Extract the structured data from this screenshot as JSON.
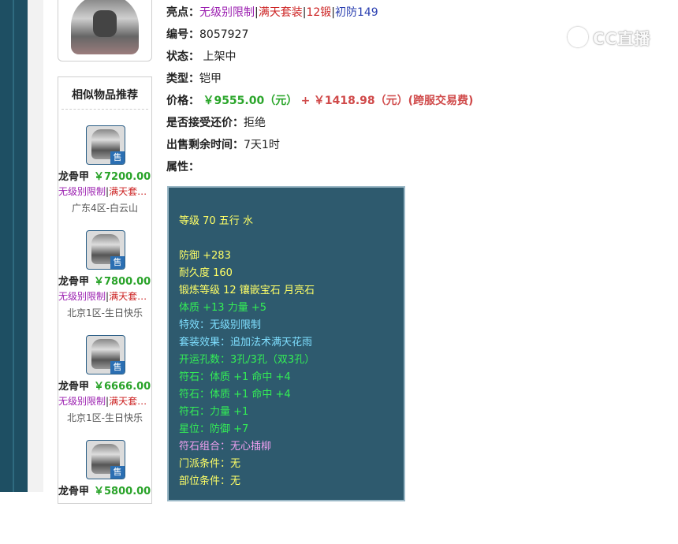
{
  "details": {
    "highlight_label": "亮点：",
    "highlights": [
      "无级别限制",
      "满天套装",
      "12锻",
      "初防149"
    ],
    "serial_label": "编号：",
    "serial": "8057927",
    "status_label": "状态：",
    "status": "上架中",
    "type_label": "类型：",
    "type": "铠甲",
    "price_label": "价格：",
    "price_main": "￥9555.00（元）",
    "price_plus": "+",
    "price_fee": "￥1418.98（元）(跨服交易费)",
    "counter_label": "是否接受还价：",
    "counter": "拒绝",
    "remaining_label": "出售剩余时间：",
    "remaining": "7天1时",
    "attr_label": "属性："
  },
  "attributes": {
    "level": "等级 70 五行 水",
    "defense": "防御 +283",
    "durability": "耐久度 160",
    "forge": "锻炼等级 12 镶嵌宝石 月亮石",
    "stats": "体质 +13 力量 +5",
    "special": "特效：无级别限制",
    "set_effect": "套装效果：追加法术满天花雨",
    "holes": "开运孔数：3孔/3孔（双3孔）",
    "rune1": "符石：体质 +1 命中 +4",
    "rune2": "符石：体质 +1 命中 +4",
    "rune3": "符石：力量 +1",
    "star": "星位：防御 +7",
    "rune_combo": "符石组合：无心插柳",
    "sect_req": "门派条件：无",
    "part_req": "部位条件：无"
  },
  "similar": {
    "title": "相似物品推荐",
    "sell_badge": "售",
    "items": [
      {
        "name": "龙骨甲",
        "price": "￥7200.00",
        "tag1": "无级别限制",
        "tag2": "满天套…",
        "server": "广东4区-白云山"
      },
      {
        "name": "龙骨甲",
        "price": "￥7800.00",
        "tag1": "无级别限制",
        "tag2": "满天套…",
        "server": "北京1区-生日快乐"
      },
      {
        "name": "龙骨甲",
        "price": "￥6666.00",
        "tag1": "无级别限制",
        "tag2": "满天套…",
        "server": "北京1区-生日快乐"
      },
      {
        "name": "龙骨甲",
        "price": "￥5800.00",
        "tag1": "",
        "tag2": "",
        "server": ""
      }
    ]
  },
  "watermark": {
    "text": "CC直播"
  },
  "colors": {
    "rail": "#1e4f63",
    "attr_bg": "#2e5a6e",
    "price_green": "#2aa52a",
    "price_red": "#d04a4a",
    "tag_purple": "#9b1fb0",
    "tag_red": "#cc2222"
  }
}
